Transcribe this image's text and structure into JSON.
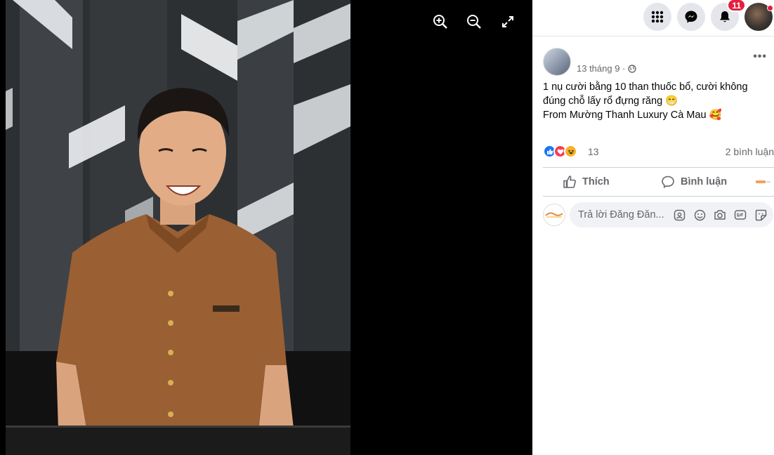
{
  "viewer": {
    "icons": [
      "zoom-in-icon",
      "zoom-out-icon",
      "fullscreen-icon"
    ]
  },
  "topbar": {
    "icons": [
      "menu-grid-icon",
      "messenger-icon",
      "bell-icon"
    ],
    "notification_count": "11"
  },
  "post": {
    "author": "",
    "time": "13 tháng 9 ·",
    "body_lines": [
      "1 nụ cười bằng 10 than thuốc bổ, cười không",
      "đúng chỗ lấy rổ đựng răng 😁",
      "From Mường Thanh Luxury Cà Mau 🥰"
    ],
    "reaction_count": "13",
    "comment_count": "2 bình luận",
    "like_label": "Thích",
    "comment_label": "Bình luận",
    "reply_placeholder": "Trả lời Đăng Đăn..."
  },
  "colors": {
    "like_blue": "#1877f2",
    "love_red": "#f33e58",
    "haha_yellow": "#f7b125",
    "badge_red": "#e41e3f",
    "secondary_text": "#65676b"
  }
}
